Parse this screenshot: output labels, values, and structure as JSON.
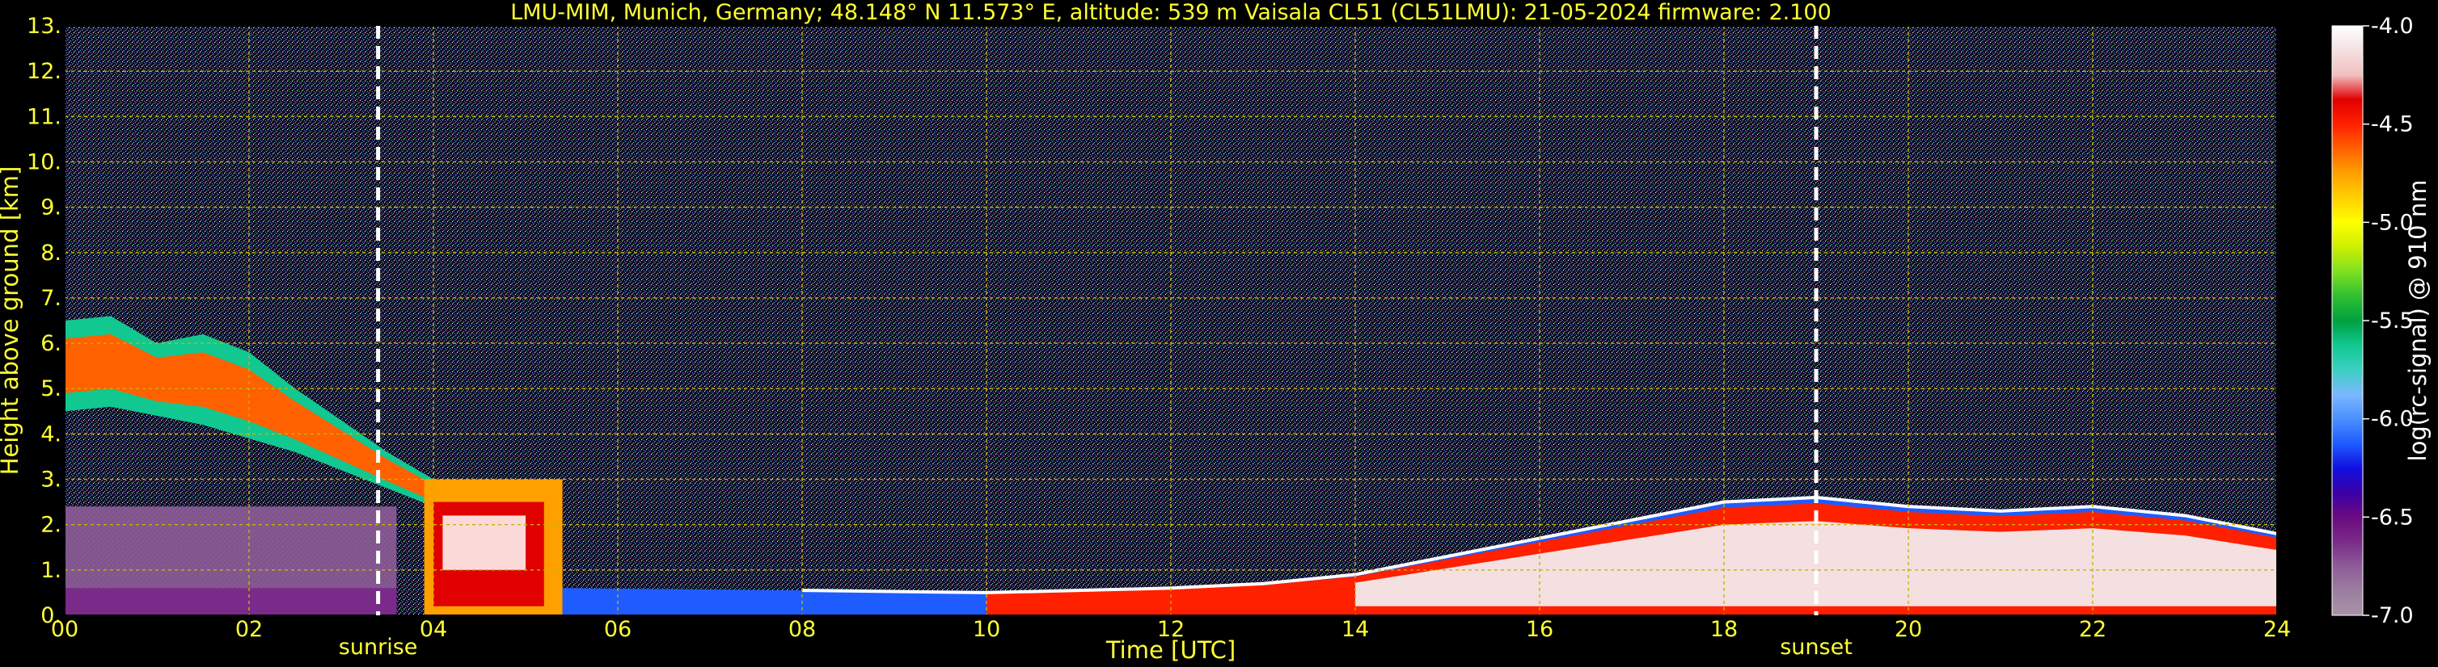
{
  "chart_data": {
    "type": "heatmap",
    "title": "LMU-MIM, Munich, Germany; 48.148° N 11.573° E, altitude: 539 m    Vaisala CL51 (CL51LMU): 21-05-2024    firmware: 2.100",
    "xlabel": "Time [UTC]",
    "ylabel": "Height above ground [km]",
    "xlim": [
      0,
      24
    ],
    "ylim": [
      0,
      13
    ],
    "x_ticks": [
      0,
      2,
      4,
      6,
      8,
      10,
      12,
      14,
      16,
      18,
      20,
      22,
      24
    ],
    "x_tick_labels": [
      "00",
      "02",
      "04",
      "06",
      "08",
      "10",
      "12",
      "14",
      "16",
      "18",
      "20",
      "22",
      "24"
    ],
    "y_ticks": [
      0,
      1,
      2,
      3,
      4,
      5,
      6,
      7,
      8,
      9,
      10,
      11,
      12,
      13
    ],
    "y_tick_labels": [
      "0.",
      "1.",
      "2.",
      "3.",
      "4.",
      "5.",
      "6.",
      "7.",
      "8.",
      "9.",
      "10.",
      "11.",
      "12.",
      "13."
    ],
    "grid": true,
    "events": [
      {
        "label": "sunrise",
        "time_utc": 3.4
      },
      {
        "label": "sunset",
        "time_utc": 19.0
      }
    ],
    "colorbar": {
      "label": "log(rc-signal) @ 910 nm",
      "range": [
        -7.0,
        -4.0
      ],
      "ticks": [
        -7.0,
        -6.5,
        -6.0,
        -5.5,
        -5.0,
        -4.5,
        -4.0
      ],
      "tick_labels": [
        "-7.0",
        "-6.5",
        "-6.0",
        "-5.5",
        "-5.0",
        "-4.5",
        "-4.0"
      ],
      "colors": [
        "#a894a8",
        "#9c7ea0",
        "#8e5c98",
        "#7a2a88",
        "#6a0a80",
        "#3a00a8",
        "#1010e0",
        "#1e5cff",
        "#4a90ff",
        "#7ab8ff",
        "#3ad0c0",
        "#10c890",
        "#00a040",
        "#30c030",
        "#80e020",
        "#ccf000",
        "#ffff00",
        "#ffd000",
        "#ffa000",
        "#ff6000",
        "#ff2000",
        "#e00000",
        "#f0c0c0",
        "#f4e0e0",
        "#ffffff"
      ]
    },
    "features": [
      {
        "name": "elevated aerosol/cloud layer",
        "t": [
          0,
          0.5,
          1.0,
          1.5,
          2.0,
          2.5,
          3.0,
          3.5,
          4.0
        ],
        "base_km": [
          4.5,
          4.6,
          4.4,
          4.2,
          3.9,
          3.6,
          3.2,
          2.8,
          2.4
        ],
        "top_km": [
          6.5,
          6.6,
          6.0,
          6.2,
          5.8,
          5.0,
          4.3,
          3.6,
          3.0
        ]
      },
      {
        "name": "boundary layer top",
        "t": [
          8,
          10,
          12,
          13,
          14,
          15,
          16,
          17,
          18,
          19,
          20,
          21,
          22,
          23,
          24
        ],
        "height_km": [
          0.55,
          0.5,
          0.6,
          0.7,
          0.9,
          1.3,
          1.7,
          2.1,
          2.5,
          2.6,
          2.4,
          2.3,
          2.4,
          2.2,
          1.8
        ]
      }
    ]
  }
}
